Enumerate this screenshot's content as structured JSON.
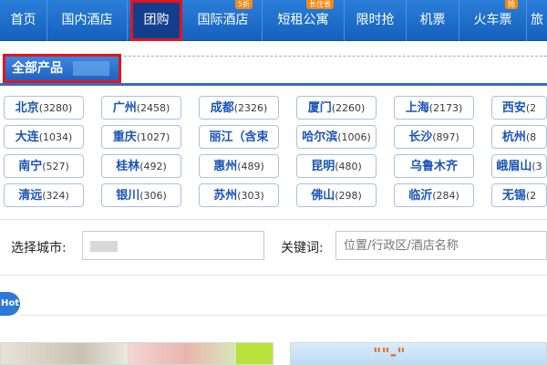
{
  "nav": {
    "items": [
      {
        "label": "首页"
      },
      {
        "label": "国内酒店"
      },
      {
        "label": "团购",
        "active": true
      },
      {
        "label": "国际酒店",
        "badge": "5折"
      },
      {
        "label": "短租公寓",
        "badge": "长住省"
      },
      {
        "label": "限时抢"
      },
      {
        "label": "机票"
      },
      {
        "label": "火车票",
        "badge": "抢"
      },
      {
        "label": "旅"
      }
    ]
  },
  "section": {
    "title": "全部产品"
  },
  "cities": [
    [
      "北京",
      "(3280)"
    ],
    [
      "广州",
      "(2458)"
    ],
    [
      "成都",
      "(2326)"
    ],
    [
      "厦门",
      "(2260)"
    ],
    [
      "上海",
      "(2173)"
    ],
    [
      "西安",
      "(2"
    ],
    [
      "大连",
      "(1034)"
    ],
    [
      "重庆",
      "(1027)"
    ],
    [
      "丽江（含束",
      ""
    ],
    [
      "哈尔滨",
      "(1006)"
    ],
    [
      "长沙",
      "(897)"
    ],
    [
      "杭州",
      "(8"
    ],
    [
      "南宁",
      "(527)"
    ],
    [
      "桂林",
      "(492)"
    ],
    [
      "惠州",
      "(489)"
    ],
    [
      "昆明",
      "(480)"
    ],
    [
      "乌鲁木齐",
      ""
    ],
    [
      "峨眉山",
      "(3"
    ],
    [
      "清远",
      "(324)"
    ],
    [
      "银川",
      "(306)"
    ],
    [
      "苏州",
      "(303)"
    ],
    [
      "佛山",
      "(298)"
    ],
    [
      "临沂",
      "(284)"
    ],
    [
      "无锡",
      "(2"
    ]
  ],
  "search": {
    "city_label": "选择城市:",
    "keyword_label": "关键词:",
    "keyword_placeholder": "位置/行政区/酒店名称"
  },
  "hot_badge": "Hot",
  "banner_text": "\"\"-\""
}
